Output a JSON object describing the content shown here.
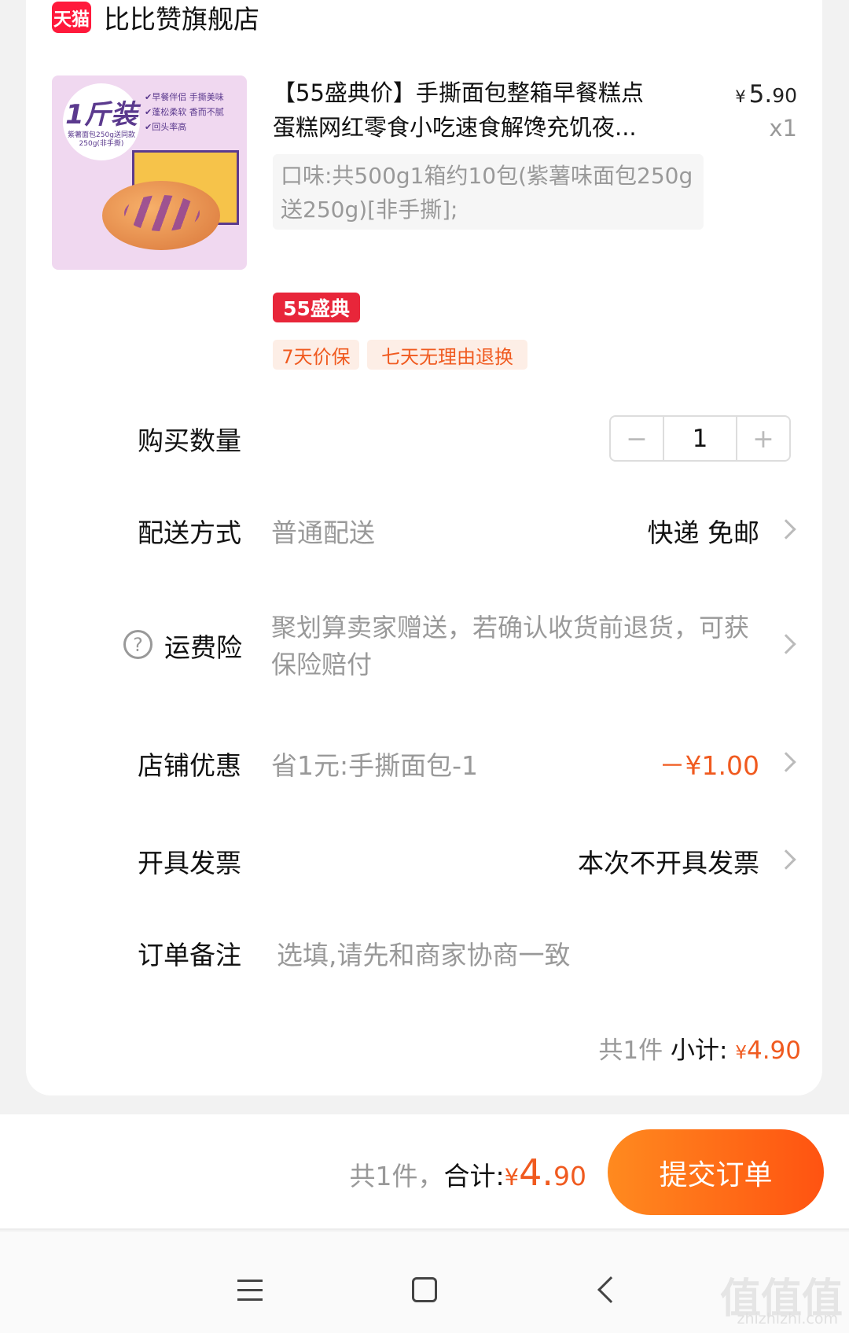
{
  "shop": {
    "badge": "天猫",
    "name": "比比赞旗舰店"
  },
  "product": {
    "thumb_big": "1斤装",
    "thumb_small": "紫薯面包250g送同款250g(非手撕)",
    "thumb_checks": [
      "早餐伴侣 手撕美味",
      "蓬松柔软 香而不腻",
      "回头率高"
    ],
    "title_line1": "【55盛典价】手撕面包整箱早餐糕点",
    "title_line2": "蛋糕网红零食小吃速食解馋充饥夜...",
    "price_yen": "¥",
    "price_int": "5.",
    "price_dec": "90",
    "qty": "x1",
    "spec": "口味:共500g1箱约10包(紫薯味面包250g送250g)[非手撕];",
    "promo_tag": "55盛典",
    "service_tags": [
      "7天价保",
      "七天无理由退换"
    ]
  },
  "quantity": {
    "label": "购买数量",
    "value": "1",
    "minus": "−",
    "plus": "+"
  },
  "delivery": {
    "label": "配送方式",
    "value": "普通配送",
    "right": "快递 免邮"
  },
  "insurance": {
    "label": "运费险",
    "icon_glyph": "?",
    "text": "聚划算卖家赠送，若确认收货前退货，可获保险赔付"
  },
  "shop_discount": {
    "label": "店铺优惠",
    "value": "省1元:手撕面包-1",
    "amount": "－¥1.00"
  },
  "invoice": {
    "label": "开具发票",
    "right": "本次不开具发票"
  },
  "remark": {
    "label": "订单备注",
    "placeholder": "选填,请先和商家协商一致"
  },
  "subtotal": {
    "count": "共1件",
    "label": "小计:",
    "yen": "¥",
    "amount": "4.90"
  },
  "footer": {
    "count": "共1件，",
    "label": "合计:",
    "yen": "¥",
    "int": "4.",
    "dec": "90",
    "submit": "提交订单"
  },
  "watermark": {
    "main": "值值值",
    "sub": "zhizhizhi.com"
  },
  "colors": {
    "accent": "#f05a1f",
    "tmall": "#ff1a3c",
    "button_start": "#ff8a1f",
    "button_end": "#ff5311"
  }
}
